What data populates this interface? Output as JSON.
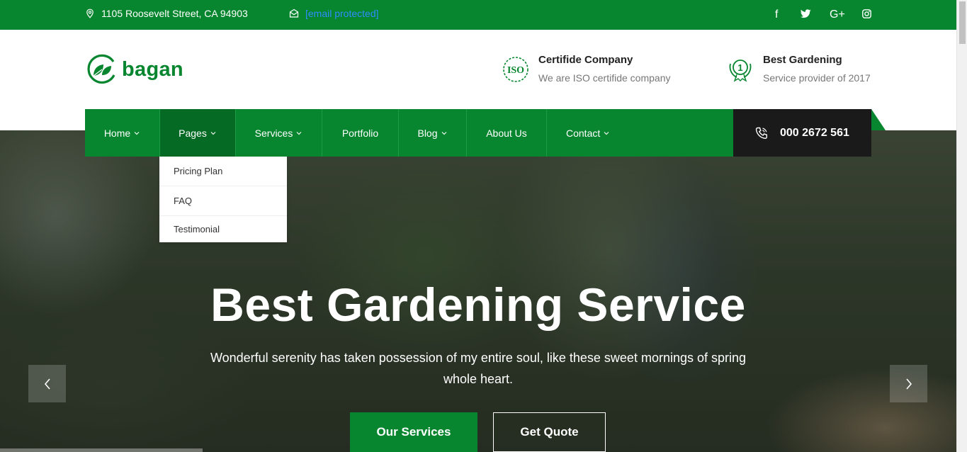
{
  "topbar": {
    "address": "1105 Roosevelt Street, CA 94903",
    "email": "[email protected]",
    "social": [
      "facebook-icon",
      "twitter-icon",
      "google-plus-icon",
      "instagram-icon"
    ],
    "social_glyphs": [
      "f",
      "",
      "G+",
      ""
    ]
  },
  "header": {
    "brand": "bagan",
    "info": [
      {
        "title": "Certifide Company",
        "subtitle": "We are ISO certifide company",
        "icon": "iso-badge-icon"
      },
      {
        "title": "Best Gardening",
        "subtitle": "Service provider of 2017",
        "icon": "award-badge-icon"
      }
    ]
  },
  "nav": {
    "items": [
      {
        "label": "Home",
        "dropdown": true
      },
      {
        "label": "Pages",
        "dropdown": true,
        "active": true
      },
      {
        "label": "Services",
        "dropdown": true
      },
      {
        "label": "Portfolio",
        "dropdown": false
      },
      {
        "label": "Blog",
        "dropdown": true
      },
      {
        "label": "About Us",
        "dropdown": false
      },
      {
        "label": "Contact",
        "dropdown": true
      }
    ],
    "phone": "000 2672 561"
  },
  "dropdown": {
    "items": [
      "Pricing Plan",
      "FAQ",
      "Testimonial"
    ]
  },
  "hero": {
    "title": "Best Gardening Service",
    "subtitle": "Wonderful serenity has taken possession of my entire soul, like these sweet mornings of spring whole heart.",
    "primary_button": "Our Services",
    "secondary_button": "Get Quote"
  },
  "colors": {
    "brand_green": "#08862f",
    "dark": "#1a1a1a",
    "link_blue": "#2f8cff"
  }
}
